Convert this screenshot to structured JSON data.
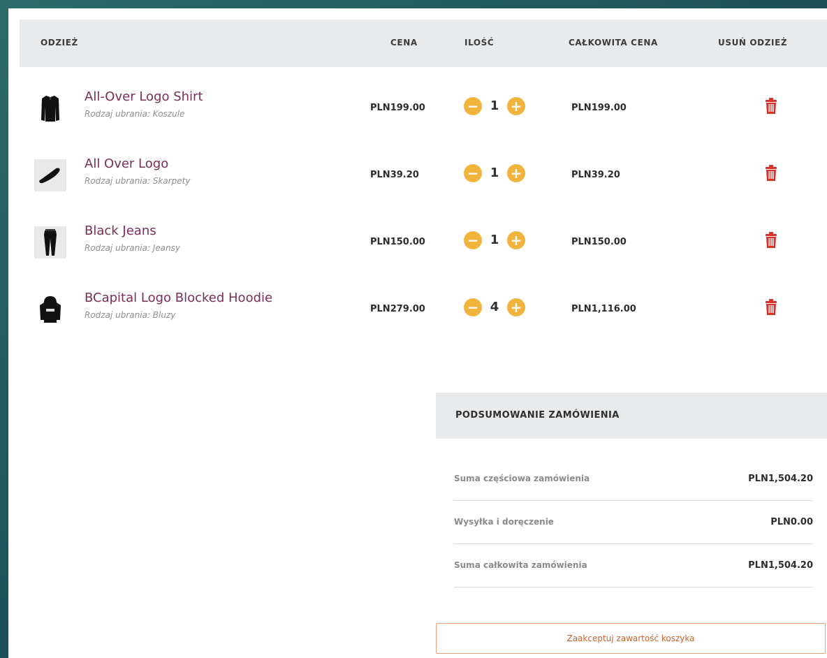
{
  "table": {
    "headers": {
      "item": "ODZIEŻ",
      "price": "CENA",
      "qty": "ILOŚĆ",
      "total": "CAŁKOWITA CENA",
      "remove": "USUŃ ODZIEŻ"
    },
    "rows": [
      {
        "name": "All-Over Logo Shirt",
        "category": "Rodzaj ubrania: Koszule",
        "price": "PLN199.00",
        "qty": "1",
        "total": "PLN199.00",
        "thumb_icon": "shirt-thumbnail"
      },
      {
        "name": "All Over Logo",
        "category": "Rodzaj ubrania: Skarpety",
        "price": "PLN39.20",
        "qty": "1",
        "total": "PLN39.20",
        "thumb_icon": "socks-thumbnail"
      },
      {
        "name": "Black Jeans",
        "category": "Rodzaj ubrania: Jeansy",
        "price": "PLN150.00",
        "qty": "1",
        "total": "PLN150.00",
        "thumb_icon": "jeans-thumbnail"
      },
      {
        "name": "BCapital Logo Blocked Hoodie",
        "category": "Rodzaj ubrania: Bluzy",
        "price": "PLN279.00",
        "qty": "4",
        "total": "PLN1,116.00",
        "thumb_icon": "hoodie-thumbnail"
      }
    ],
    "controls": {
      "minus": "−",
      "plus": "+"
    }
  },
  "summary": {
    "title": "PODSUMOWANIE ZAMÓWIENIA",
    "rows": [
      {
        "label": "Suma częściowa zamówienia",
        "value": "PLN1,504.20"
      },
      {
        "label": "Wysyłka i doręczenie",
        "value": "PLN0.00"
      },
      {
        "label": "Suma całkowita zamówienia",
        "value": "PLN1,504.20"
      }
    ],
    "accept_label": "Zaakceptuj zawartość koszyka"
  },
  "colors": {
    "product_name": "#7a2d55",
    "qty_button": "#f0b43c",
    "trash": "#d9342b",
    "accept_border": "#e8a07a",
    "accept_text": "#c8632e",
    "header_bg": "#e8eaec"
  }
}
